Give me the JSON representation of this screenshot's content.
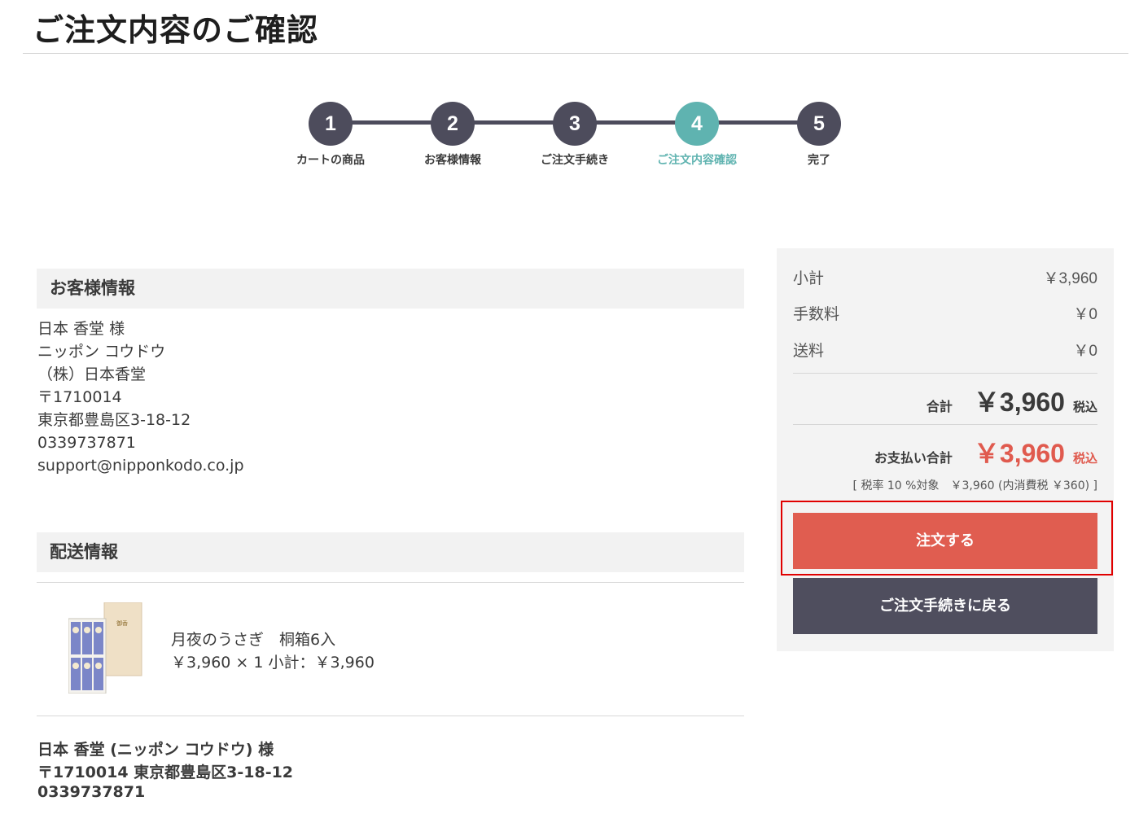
{
  "page": {
    "title": "ご注文内容のご確認"
  },
  "steps": [
    {
      "number": "1",
      "label": "カートの商品",
      "active": false
    },
    {
      "number": "2",
      "label": "お客様情報",
      "active": false
    },
    {
      "number": "3",
      "label": "ご注文手続き",
      "active": false
    },
    {
      "number": "4",
      "label": "ご注文内容確認",
      "active": true
    },
    {
      "number": "5",
      "label": "完了",
      "active": false
    }
  ],
  "customer": {
    "heading": "お客様情報",
    "name": "日本 香堂 様",
    "kana": "ニッポン コウドウ",
    "company": "（株）日本香堂",
    "postal": "〒1710014",
    "address": "東京都豊島区3-18-12",
    "phone": "0339737871",
    "email": "support@nipponkodo.co.jp"
  },
  "shipping": {
    "heading": "配送情報",
    "product_name": "月夜のうさぎ　桐箱6入",
    "product_price_line": "￥3,960 × 1  小計：￥3,960",
    "recipient": "日本 香堂 (ニッポン コウドウ) 様",
    "recipient_address": "〒1710014 東京都豊島区3-18-12",
    "recipient_phone": "0339737871"
  },
  "summary": {
    "subtotal_label": "小計",
    "subtotal_value": "￥3,960",
    "fee_label": "手数料",
    "fee_value": "￥0",
    "shipping_label": "送料",
    "shipping_value": "￥0",
    "total_label": "合計",
    "total_value": "￥3,960",
    "total_tax": "税込",
    "payment_label": "お支払い合計",
    "payment_value": "￥3,960",
    "payment_tax": "税込",
    "tax_note": "[ 税率 10 %対象　￥3,960 (内消費税 ￥360) ]",
    "order_button": "注文する",
    "back_button": "ご注文手続きに戻る"
  },
  "colors": {
    "accent": "#5fb3b0",
    "dark": "#4d4c5c",
    "order_red": "#e05d50",
    "highlight": "#e00000"
  }
}
